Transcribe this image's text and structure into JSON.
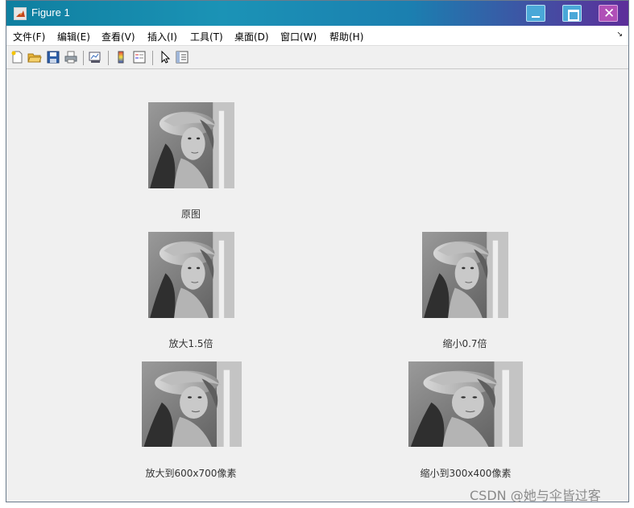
{
  "window": {
    "title": "Figure 1",
    "app_icon": "matlab-icon"
  },
  "title_buttons": {
    "minimize": "minimize-icon",
    "maximize": "maximize-icon",
    "close": "close-icon"
  },
  "menu": {
    "items": [
      "文件(F)",
      "编辑(E)",
      "查看(V)",
      "插入(I)",
      "工具(T)",
      "桌面(D)",
      "窗口(W)",
      "帮助(H)"
    ],
    "dock_icon": "↘"
  },
  "toolbar": {
    "icons": [
      "new-figure-icon",
      "open-file-icon",
      "save-icon",
      "print-icon",
      "link-plot-icon",
      "colorbar-icon",
      "legend-icon",
      "edit-plot-pointer-icon",
      "property-inspector-icon"
    ]
  },
  "subplots": [
    {
      "caption": "原图"
    },
    {
      "caption": "放大1.5倍"
    },
    {
      "caption": "缩小0.7倍"
    },
    {
      "caption": "放大到600x700像素"
    },
    {
      "caption": "缩小到300x400像素"
    }
  ],
  "watermark": "CSDN @她与伞皆过客"
}
